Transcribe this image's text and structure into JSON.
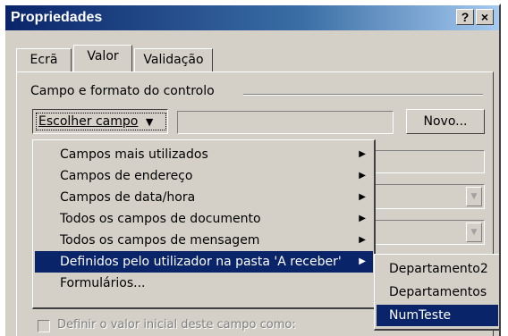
{
  "window": {
    "title": "Propriedades",
    "help_label": "?",
    "close_label": "×"
  },
  "tabs": [
    {
      "label": "Ecrã"
    },
    {
      "label": "Valor"
    },
    {
      "label": "Validação"
    }
  ],
  "active_tab": "Valor",
  "group": {
    "label": "Campo e formato do controlo"
  },
  "choose_field_button": {
    "label": "Escolher campo",
    "arrow": "▼"
  },
  "field_input": {
    "value": ""
  },
  "new_button": {
    "label": "Novo..."
  },
  "menu": {
    "items": [
      {
        "label": "Campos mais utilizados",
        "has_submenu": true
      },
      {
        "label": "Campos de endereço",
        "has_submenu": true
      },
      {
        "label": "Campos de data/hora",
        "has_submenu": true
      },
      {
        "label": "Todos os campos de documento",
        "has_submenu": true
      },
      {
        "label": "Todos os campos de mensagem",
        "has_submenu": true
      },
      {
        "label": "Definidos pelo utilizador na pasta 'A receber'",
        "has_submenu": true,
        "selected": true
      },
      {
        "label": "Formulários...",
        "has_submenu": false
      }
    ],
    "arrow_glyph": "▶"
  },
  "submenu": {
    "items": [
      {
        "label": "Departamento2"
      },
      {
        "label": "Departamentos"
      },
      {
        "label": "NumTeste",
        "selected": true
      }
    ]
  },
  "initial_value_checkbox": {
    "label": "Definir o valor inicial deste campo como:",
    "checked": false
  },
  "colors": {
    "dialog_bg": "#d4d0c8",
    "title_start": "#0a246a",
    "title_end": "#a6caf0",
    "highlight": "#0a246a"
  }
}
